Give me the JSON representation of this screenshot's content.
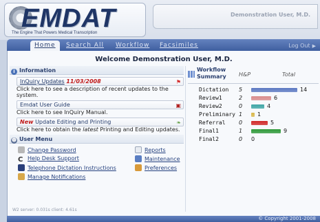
{
  "header": {
    "logo_text": "EMDAT",
    "logo_tagline": "The Engine That Powers Medical Transcription",
    "user_display": "Demonstration User, M.D."
  },
  "nav": {
    "tabs": [
      {
        "label": "Home",
        "active": true
      },
      {
        "label": "Search All",
        "active": false
      },
      {
        "label": "Workflow",
        "active": false
      },
      {
        "label": "Facsimiles",
        "active": false
      }
    ],
    "logout": "Log Out"
  },
  "main": {
    "welcome": "Welcome Demonstration User, M.D.",
    "information": {
      "title": "Information",
      "items": [
        {
          "prefix": "",
          "label": "InQuiry Updates",
          "date": "11/03/2008",
          "icon": "flag-icon",
          "desc": "Click here to see a description of recent updates to the system."
        },
        {
          "prefix": "",
          "label": "Emdat User Guide",
          "date": "",
          "icon": "pdf-icon",
          "desc": "Click here to see InQuiry Manual."
        },
        {
          "prefix": "New",
          "label": "Update Editing and Printing",
          "date": "",
          "icon": "leaf-icon",
          "desc_pre": "Click here to obtain the ",
          "desc_em": "latest",
          "desc_post": " Printing and Editing updates."
        }
      ]
    },
    "user_menu": {
      "title": "User Menu",
      "items": [
        {
          "label": "Change Password",
          "icon": "key-icon"
        },
        {
          "label": "Help Desk Support",
          "icon": "phone-icon"
        },
        {
          "label": "Telephone Dictation Instructions",
          "icon": "book-icon"
        },
        {
          "label": "Manage Notifications",
          "icon": "people-icon"
        },
        {
          "label": "Reports",
          "icon": "chart-icon"
        },
        {
          "label": "Maintenance",
          "icon": "monitor-icon"
        },
        {
          "label": "Preferences",
          "icon": "wrench-icon"
        }
      ]
    }
  },
  "workflow": {
    "title_line1": "Workflow",
    "title_line2": "Summary",
    "col_hp": "H&P",
    "col_total": "Total",
    "rows": [
      {
        "name": "Dictation",
        "hp": "5",
        "total": 14,
        "color": "#5b78c2"
      },
      {
        "name": "Review1",
        "hp": "2",
        "total": 6,
        "color": "#d98c8c"
      },
      {
        "name": "Review2",
        "hp": "0",
        "total": 4,
        "color": "#3fa6a6"
      },
      {
        "name": "Preliminary",
        "hp": "1",
        "total": 1,
        "color": "#d9b84a"
      },
      {
        "name": "Referral",
        "hp": "0",
        "total": 5,
        "color": "#d12a2a"
      },
      {
        "name": "Final1",
        "hp": "1",
        "total": 9,
        "color": "#2f9a3a"
      },
      {
        "name": "Final2",
        "hp": "0",
        "total": 0,
        "color": "#888888"
      }
    ]
  },
  "status": "W2 server: 0.031s  client: 4.61s",
  "footer": "© Copyright 2001-2008"
}
